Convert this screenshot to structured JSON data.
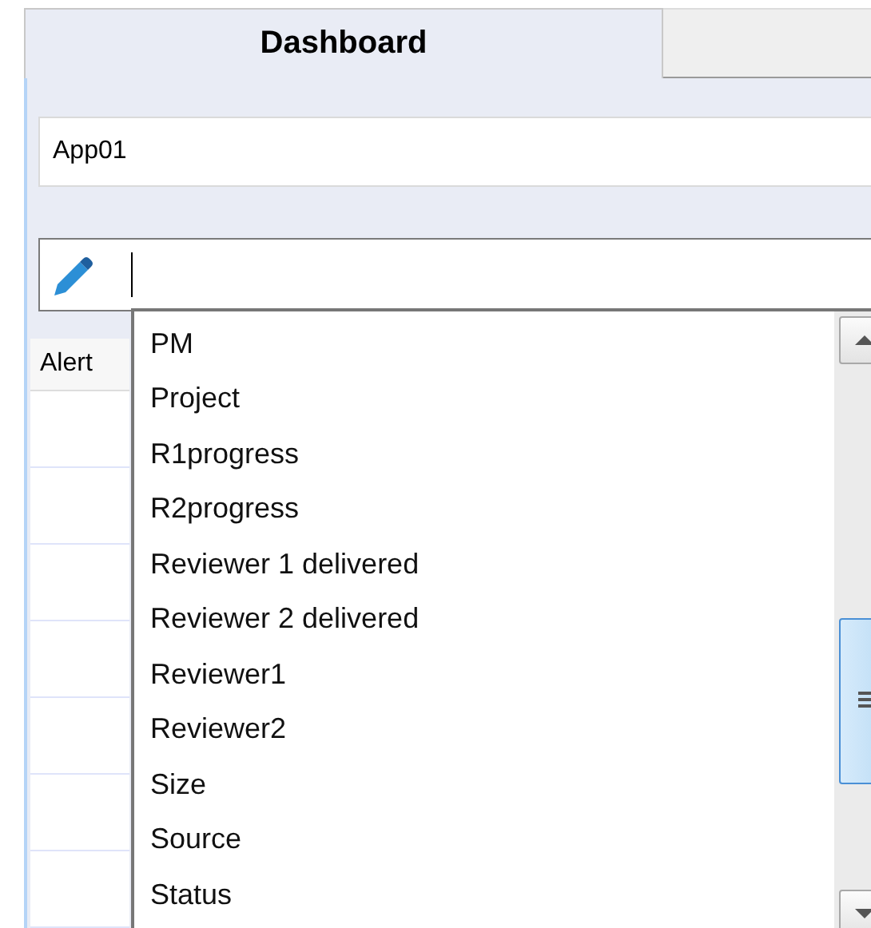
{
  "tabs": [
    {
      "label": "Dashboard",
      "selected": true
    }
  ],
  "app_field": {
    "value": "App01"
  },
  "grid": {
    "columns": [
      "Alert"
    ]
  },
  "dropdown": {
    "items": [
      "PM",
      "Project",
      "R1progress",
      "R2progress",
      "Reviewer 1 delivered",
      "Reviewer 2 delivered",
      "Reviewer1",
      "Reviewer2",
      "Size",
      "Source",
      "Status"
    ]
  }
}
